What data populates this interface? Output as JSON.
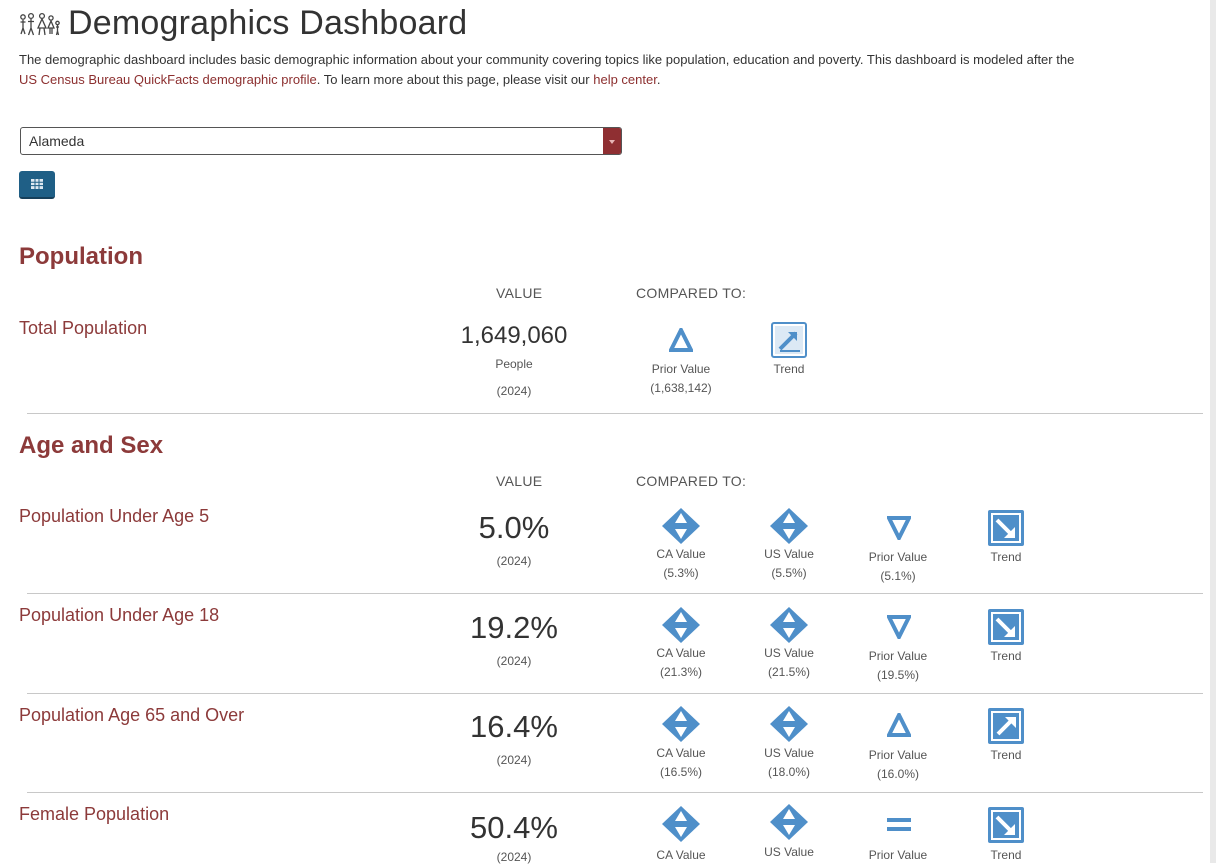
{
  "title": "Demographics Dashboard",
  "intro": {
    "text1": "The demographic dashboard includes basic demographic information about your community covering topics like population, education and poverty. This dashboard is modeled after the",
    "link1": "US Census Bureau QuickFacts demographic profile",
    "text2": ". To learn more about this page, please visit our ",
    "link2": "help center",
    "text3": "."
  },
  "location_select": {
    "value": "Alameda"
  },
  "colors": {
    "accent": "#8c3a3a",
    "icon_blue": "#4f8fc9",
    "button": "#1f5f86"
  },
  "sections": {
    "population": {
      "title": "Population",
      "value_header": "VALUE",
      "compare_header": "COMPARED TO:",
      "rows": [
        {
          "label": "Total Population",
          "value": "1,649,060",
          "unit": "People",
          "year": "(2024)",
          "prior_label": "Prior Value",
          "prior_value": "(1,638,142)",
          "prior_icon": "triangle-up-outline-icon",
          "trend_label": "Trend",
          "trend_icon": "trend-up-icon"
        }
      ]
    },
    "age_sex": {
      "title": "Age and Sex",
      "value_header": "VALUE",
      "compare_header": "COMPARED TO:",
      "rows": [
        {
          "label": "Population Under Age 5",
          "value": "5.0%",
          "year": "(2024)",
          "ca_label": "CA Value",
          "ca_value": "(5.3%)",
          "us_label": "US Value",
          "us_value": "(5.5%)",
          "prior_label": "Prior Value",
          "prior_value": "(5.1%)",
          "prior_icon": "triangle-down-outline-icon",
          "trend_label": "Trend",
          "trend_icon": "trend-down-icon"
        },
        {
          "label": "Population Under Age 18",
          "value": "19.2%",
          "year": "(2024)",
          "ca_label": "CA Value",
          "ca_value": "(21.3%)",
          "us_label": "US Value",
          "us_value": "(21.5%)",
          "prior_label": "Prior Value",
          "prior_value": "(19.5%)",
          "prior_icon": "triangle-down-outline-icon",
          "trend_label": "Trend",
          "trend_icon": "trend-down-icon"
        },
        {
          "label": "Population Age 65 and Over",
          "value": "16.4%",
          "year": "(2024)",
          "ca_label": "CA Value",
          "ca_value": "(16.5%)",
          "us_label": "US Value",
          "us_value": "(18.0%)",
          "prior_label": "Prior Value",
          "prior_value": "(16.0%)",
          "prior_icon": "triangle-up-outline-icon",
          "trend_label": "Trend",
          "trend_icon": "trend-up-icon"
        },
        {
          "label": "Female Population",
          "value": "50.4%",
          "year": "(2024)",
          "ca_label": "CA Value",
          "us_label": "US Value",
          "prior_label": "Prior Value",
          "prior_icon": "equal-icon",
          "trend_label": "Trend",
          "trend_icon": "trend-down-icon"
        }
      ]
    }
  }
}
